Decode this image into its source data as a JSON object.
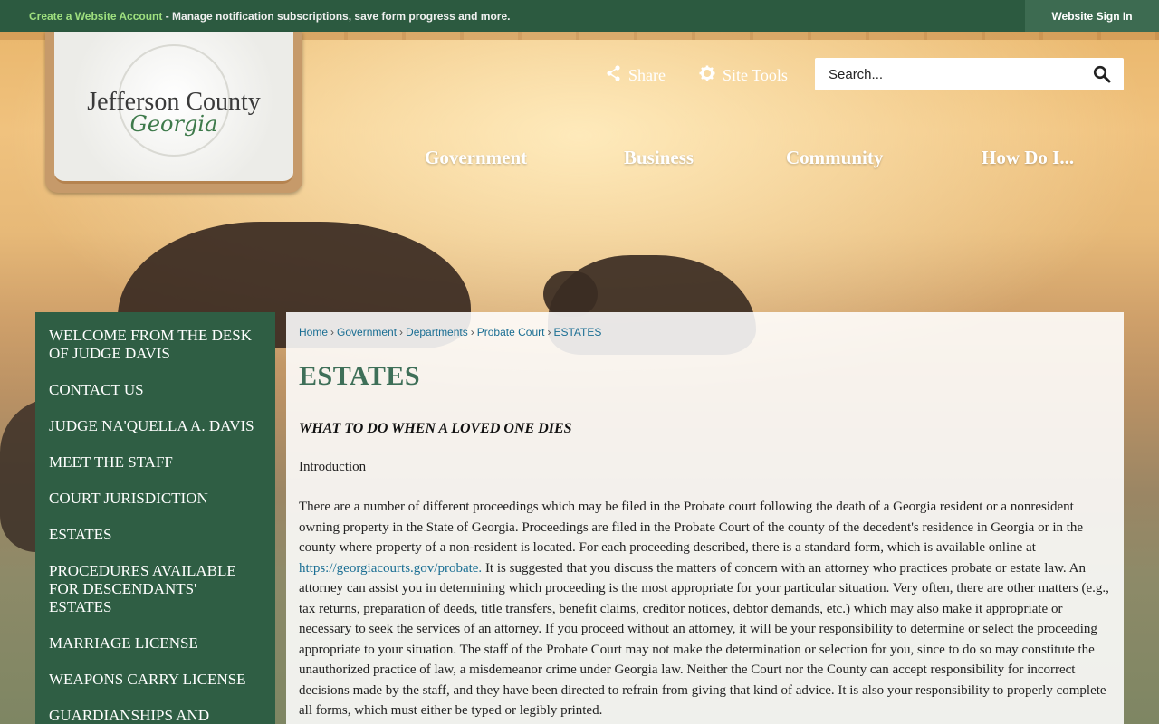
{
  "topbar": {
    "create_link": "Create a Website Account",
    "create_desc": " - Manage notification subscriptions, save form progress and more.",
    "signin": "Website Sign In"
  },
  "logo": {
    "county": "Jefferson County",
    "state": "Georgia"
  },
  "utility": {
    "share": "Share",
    "site_tools": "Site Tools"
  },
  "search": {
    "placeholder": "Search..."
  },
  "nav": [
    "Government",
    "Business",
    "Community",
    "How Do I..."
  ],
  "sidebar": {
    "items": [
      "Welcome from the Desk of Judge Davis",
      "Contact Us",
      "Judge Na'Quella  A. Davis",
      "Meet the Staff",
      "Court Jurisdiction",
      "Estates",
      "Procedures Available for Descendants' Estates",
      "Marriage License",
      "Weapons Carry License",
      "Guardianships and"
    ]
  },
  "breadcrumb": [
    "Home",
    "Government",
    "Departments",
    "Probate Court",
    "ESTATES"
  ],
  "page": {
    "title": "ESTATES",
    "subhead": "WHAT TO DO WHEN A LOVED ONE DIES",
    "intro": "Introduction",
    "p1_a": "There are a number of different proceedings which may be filed in the Probate court following the death of a Georgia resident or a nonresident owning property in the State of Georgia. Proceedings are filed in the Probate Court of the county of the decedent's residence in Georgia or in the county where property of a non-resident is located. For each proceeding described, there is a standard form, which is available online at",
    "p1_link": " https://georgiacourts.gov/probate.",
    "p1_b": " It is suggested that you discuss the matters of concern with an attorney who practices probate or estate law. An attorney can assist you in determining which proceeding is the most appropriate for your particular situation. Very often, there are other matters (e.g., tax returns, preparation of deeds, title transfers, benefit claims, creditor notices, debtor demands, etc.) which may also make it appropriate or necessary to seek the services of an attorney. If you proceed without an attorney, it will be your responsibility to determine or select the proceeding appropriate to your situation. The staff of the Probate Court may not make the determination or selection for you, since to do so may constitute the unauthorized practice of law, a misdemeanor crime under Georgia law. Neither the Court nor the County can accept responsibility for incorrect decisions made by the staff, and they have been directed to refrain from giving that kind of advice. It is also your responsibility to properly complete all forms, which must either be typed or legibly printed."
  },
  "colors": {
    "topbar": "#2c5a40",
    "sidebar": "#2f5e44",
    "title": "#3e6f58",
    "link": "#1a6e93",
    "create_link": "#9fe07f"
  }
}
